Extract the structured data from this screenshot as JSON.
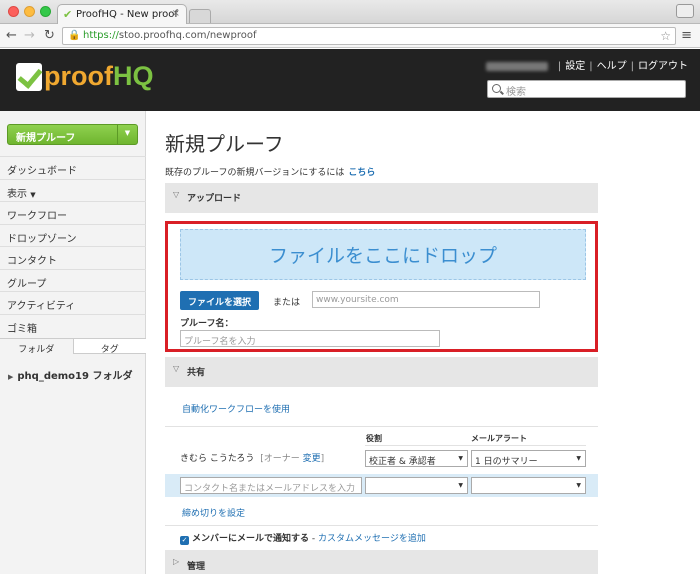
{
  "browser": {
    "tab_title": "ProofHQ - New proof",
    "tab_close": "×",
    "url_scheme": "https://",
    "url_rest": "stoo.proofhq.com/newproof"
  },
  "header": {
    "logo_proof": "proof",
    "logo_hq": "HQ",
    "links": [
      "設定",
      "ヘルプ",
      "ログアウト"
    ],
    "search_placeholder": "検索"
  },
  "sidebar": {
    "new_proof_label": "新規プルーフ",
    "items": [
      "ダッシュボード",
      "表示",
      "ワークフロー",
      "ドロップゾーン",
      "コンタクト",
      "グループ",
      "アクティビティ",
      "ゴミ箱"
    ],
    "tabs": [
      "フォルダ",
      "タグ"
    ],
    "folder": "phq_demo19 フォルダ"
  },
  "main": {
    "title": "新規プルーフ",
    "intro_text": "既存のプルーフの新規バージョンにするには",
    "intro_link": "こちら",
    "upload": {
      "section_label": "アップロード",
      "dropzone_text": "ファイルをここにドロップ",
      "choose_file": "ファイルを選択",
      "or_label": "または",
      "url_placeholder": "www.yoursite.com",
      "name_label": "プルーフ名：",
      "name_placeholder": "プルーフ名を入力"
    },
    "share": {
      "section_label": "共有",
      "auto_workflow": "自動化ワークフローを使用",
      "col_role": "役割",
      "col_alert": "メールアラート",
      "member_name": "きむら こうたろう",
      "owner_open": "[オーナー",
      "owner_change": "変更",
      "owner_close": "]",
      "member_role": "校正者 & 承認者",
      "member_alert": "1 日のサマリー",
      "contact_placeholder": "コンタクト名またはメールアドレスを入力",
      "deadline_link": "締め切りを設定",
      "notify_label": "メンバーにメールで通知する",
      "notify_sep": " - ",
      "custom_message": "カスタムメッセージを追加"
    },
    "manage": {
      "section_label": "管理"
    }
  }
}
